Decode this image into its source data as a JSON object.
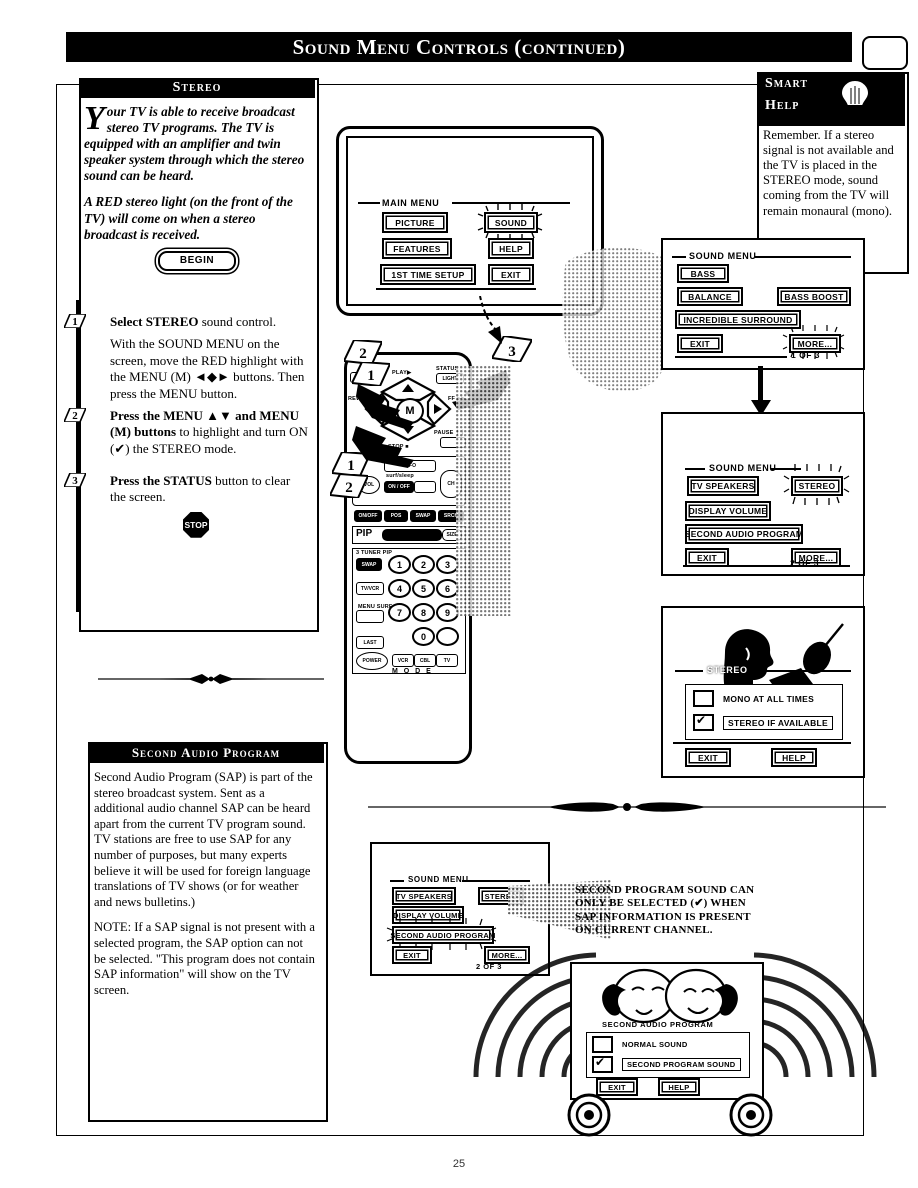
{
  "page": {
    "header_title": "Sound Menu Controls (continued)",
    "page_number": "25"
  },
  "stereo_panel": {
    "header": "Stereo",
    "dropcap": "Y",
    "paragraph1": "our TV is able to receive broadcast stereo TV programs. The TV is equipped with an amplifier and twin speaker system through which the stereo sound can be heard.",
    "paragraph2": "A RED stereo light (on the front of the TV) will come on when a stereo broadcast is received.",
    "begin_label": "BEGIN",
    "steps": [
      {
        "number": "1",
        "heading": "Select STEREO",
        "heading_rest": " sound control.",
        "body": "With the SOUND MENU on the screen, move the RED highlight with the MENU (M) ◄◆► buttons. Then press the MENU button."
      },
      {
        "number": "2",
        "heading": "Press the MENU ▲▼ and MENU (M) buttons",
        "heading_rest": " to highlight and turn ON (✔) the STEREO mode.",
        "body": ""
      },
      {
        "number": "3",
        "heading": "Press the STATUS",
        "heading_rest": " button to clear the screen.",
        "body": ""
      }
    ],
    "stop_label": "STOP"
  },
  "sap_panel": {
    "header": "Second Audio Program",
    "paragraph1": "Second Audio Program (SAP) is part of the stereo broadcast system.  Sent as a additional audio channel SAP can be heard apart from the current TV program sound. TV stations are free to use SAP for any number of purposes, but many experts believe it will be used for foreign language translations of TV shows (or for weather and news bulletins.)",
    "paragraph2": "NOTE: If a SAP signal is not present with a selected program, the SAP option can not be selected.  \"This program does not contain SAP information\" will show on the TV screen."
  },
  "smart_help": {
    "title_line1": "Smart",
    "title_line2": "Help",
    "body": "Remember. If a stereo signal is not available and the TV is placed in the STEREO mode, sound coming from the TV will remain monaural (mono)."
  },
  "main_menu_screen": {
    "title": "MAIN MENU",
    "buttons": [
      {
        "label": "PICTURE",
        "highlighted": false
      },
      {
        "label": "SOUND",
        "highlighted": true
      },
      {
        "label": "FEATURES",
        "highlighted": false
      },
      {
        "label": "HELP",
        "highlighted": false
      },
      {
        "label": "1ST TIME SETUP",
        "highlighted": false
      },
      {
        "label": "EXIT",
        "highlighted": false
      }
    ]
  },
  "sound_menu_1": {
    "title": "SOUND MENU",
    "page_indicator": "1 OF 3",
    "buttons": [
      {
        "label": "BASS",
        "highlighted": false
      },
      {
        "label": "BALANCE",
        "highlighted": false
      },
      {
        "label": "BASS BOOST",
        "highlighted": false
      },
      {
        "label": "INCREDIBLE SURROUND",
        "highlighted": false
      },
      {
        "label": "EXIT",
        "highlighted": false
      },
      {
        "label": "MORE...",
        "highlighted": true
      }
    ]
  },
  "sound_menu_2": {
    "title": "SOUND MENU",
    "page_indicator": "2 OF 3",
    "buttons": [
      {
        "label": "TV SPEAKERS",
        "highlighted": false
      },
      {
        "label": "STEREO",
        "highlighted": true
      },
      {
        "label": "DISPLAY VOLUME",
        "highlighted": false
      },
      {
        "label": "SECOND AUDIO PROGRAM",
        "highlighted": false
      },
      {
        "label": "EXIT",
        "highlighted": false
      },
      {
        "label": "MORE...",
        "highlighted": false
      }
    ]
  },
  "stereo_select_screen": {
    "title": "STEREO",
    "options": [
      {
        "label": "MONO AT ALL TIMES",
        "checked": false,
        "boxed": false
      },
      {
        "label": "STEREO IF AVAILABLE",
        "checked": true,
        "boxed": true
      }
    ],
    "buttons": [
      {
        "label": "EXIT"
      },
      {
        "label": "HELP"
      }
    ]
  },
  "sound_menu_3": {
    "title": "SOUND MENU",
    "page_indicator": "2 OF 3",
    "buttons": [
      {
        "label": "TV SPEAKERS",
        "highlighted": false
      },
      {
        "label": "STEREO",
        "highlighted": false
      },
      {
        "label": "DISPLAY VOLUME",
        "highlighted": false
      },
      {
        "label": "SECOND AUDIO PROGRAM",
        "highlighted": true
      },
      {
        "label": "EXIT",
        "highlighted": false
      },
      {
        "label": "MORE...",
        "highlighted": false
      }
    ]
  },
  "sap_caption": {
    "text": "SECOND PROGRAM SOUND CAN ONLY BE SELECTED (✔) WHEN SAP INFORMATION IS PRESENT ON CURRENT CHANNEL."
  },
  "sap_select_screen": {
    "title": "SECOND AUDIO PROGRAM",
    "options": [
      {
        "label": "NORMAL SOUND",
        "checked": false,
        "boxed": false
      },
      {
        "label": "SECOND PROGRAM SOUND",
        "checked": true,
        "boxed": true
      }
    ],
    "buttons": [
      {
        "label": "EXIT"
      },
      {
        "label": "HELP"
      }
    ]
  },
  "remote": {
    "callouts": [
      "1",
      "2",
      "3",
      "1",
      "2"
    ],
    "labels": {
      "play": "PLAY▶",
      "status": "STATUS",
      "light": "LIGHT",
      "rew": "REW ◄◄",
      "ff": "FF ▶▶",
      "cc": "CC",
      "m_button": "M",
      "stop_label": "STOP ■",
      "pause": "PAUSE ❙❙",
      "vol": "VOL",
      "ch": "CH",
      "info": "INFO",
      "surfing": "surf/sleep",
      "on_off": "ON / OFF",
      "pip": "PIP",
      "size": "SIZE",
      "three_tuner": "3 TUNER PIP",
      "swap": "SWAP",
      "tv_vcr": "TV/VCR",
      "menu_surf": "MENU SURF",
      "last": "LAST",
      "power": "POWER",
      "mode": "M O D E",
      "mode_keys": [
        "VCR",
        "CBL",
        "TV"
      ],
      "pip_row_keys": [
        "ON/OFF",
        "POS",
        "SWAP",
        "SRCH"
      ]
    },
    "keypad": [
      "1",
      "2",
      "3",
      "4",
      "5",
      "6",
      "7",
      "8",
      "9",
      "0"
    ]
  }
}
